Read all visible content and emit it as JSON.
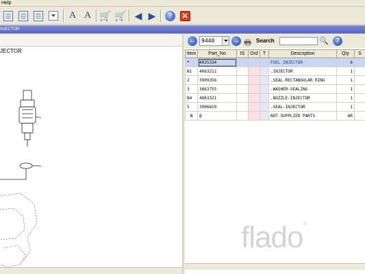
{
  "menu": {
    "help_label": "Help"
  },
  "toolbar": {
    "icons": [
      "document-icon",
      "list-icon",
      "list-doc-icon",
      "down-arrow-icon",
      "text-a-icon",
      "text-a-edit-icon",
      "cart-icon",
      "cart-remove-icon",
      "back-icon",
      "forward-icon",
      "help-icon",
      "close-icon"
    ]
  },
  "titlestrip": {
    "label": "NJECTOR"
  },
  "left": {
    "caption": "JECTOR"
  },
  "right": {
    "page_value": "9440",
    "search_label": "Search",
    "search_value": "",
    "columns": [
      "Item",
      "Part_No",
      "IS",
      "Ord",
      "T",
      "Description",
      "Qty",
      "S"
    ],
    "rows": [
      {
        "item": "*",
        "part": "4025334",
        "is": "",
        "ord": "",
        "t": "",
        "desc": "FUEL INJECTOR",
        "qty": "6",
        "s": ""
      },
      {
        "item": "N1",
        "part": "4063212",
        "is": "",
        "ord": "",
        "t": "",
        "desc": ".INJECTOR",
        "qty": "1",
        "s": ""
      },
      {
        "item": "2",
        "part": "3909356",
        "is": "",
        "ord": "",
        "t": "",
        "desc": ".SEAL-RECTANGULAR RING",
        "qty": "1",
        "s": ""
      },
      {
        "item": "3",
        "part": "3863755",
        "is": "",
        "ord": "",
        "t": "",
        "desc": ".WASHER-SEALING",
        "qty": "1",
        "s": ""
      },
      {
        "item": "N4",
        "part": "4863321",
        "is": "",
        "ord": "",
        "t": "",
        "desc": ".NOZZLE-INJECTOR",
        "qty": "1",
        "s": ""
      },
      {
        "item": "5",
        "part": "3906659",
        "is": "",
        "ord": "",
        "t": "",
        "desc": ".SEAL-INJECTOR",
        "qty": "1",
        "s": ""
      },
      {
        "item": "N",
        "part": "@",
        "is": "",
        "ord": "",
        "t": "",
        "desc": "NOT SUPPLIED PARTS",
        "qty": "AR",
        "s": ""
      }
    ]
  },
  "watermark": {
    "text": "flado",
    "mark": "®"
  },
  "colors": {
    "title_strip": "#6b76cc",
    "selected_row": "#c7d7f5",
    "ord_column": "#fbe1e6",
    "t_column": "#e6e6f6"
  }
}
